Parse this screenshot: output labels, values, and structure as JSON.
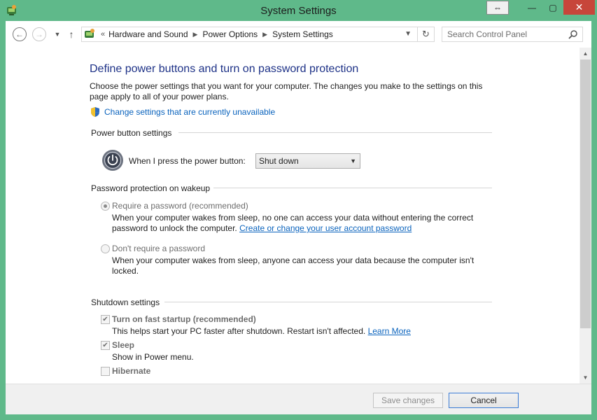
{
  "window": {
    "title": "System Settings",
    "accent_color": "#5fb98a",
    "close_color": "#c7463a",
    "icons": {
      "app": "control-panel-icon",
      "snap": "snap-arrows-icon",
      "minimize": "minimize-icon",
      "maximize": "maximize-icon",
      "close": "close-icon"
    }
  },
  "nav": {
    "breadcrumbs": [
      "Hardware and Sound",
      "Power Options",
      "System Settings"
    ],
    "search_placeholder": "Search Control Panel"
  },
  "page": {
    "heading": "Define power buttons and turn on password protection",
    "intro": "Choose the power settings that you want for your computer. The changes you make to the settings on this page apply to all of your power plans.",
    "change_unavailable_link": "Change settings that are currently unavailable"
  },
  "power_button": {
    "section_title": "Power button settings",
    "label": "When I press the power button:",
    "selected": "Shut down"
  },
  "password": {
    "section_title": "Password protection on wakeup",
    "require": {
      "label": "Require a password (recommended)",
      "checked": true,
      "desc": "When your computer wakes from sleep, no one can access your data without entering the correct password to unlock the computer.",
      "link": "Create or change your user account password"
    },
    "dont_require": {
      "label": "Don't require a password",
      "checked": false,
      "desc": "When your computer wakes from sleep, anyone can access your data because the computer isn't locked."
    }
  },
  "shutdown": {
    "section_title": "Shutdown settings",
    "fast_startup": {
      "label": "Turn on fast startup (recommended)",
      "checked": true,
      "desc": "This helps start your PC faster after shutdown. Restart isn't affected.",
      "link": "Learn More"
    },
    "sleep": {
      "label": "Sleep",
      "checked": true,
      "desc": "Show in Power menu."
    },
    "hibernate": {
      "label": "Hibernate",
      "checked": false
    }
  },
  "footer": {
    "save_label": "Save changes",
    "cancel_label": "Cancel"
  }
}
